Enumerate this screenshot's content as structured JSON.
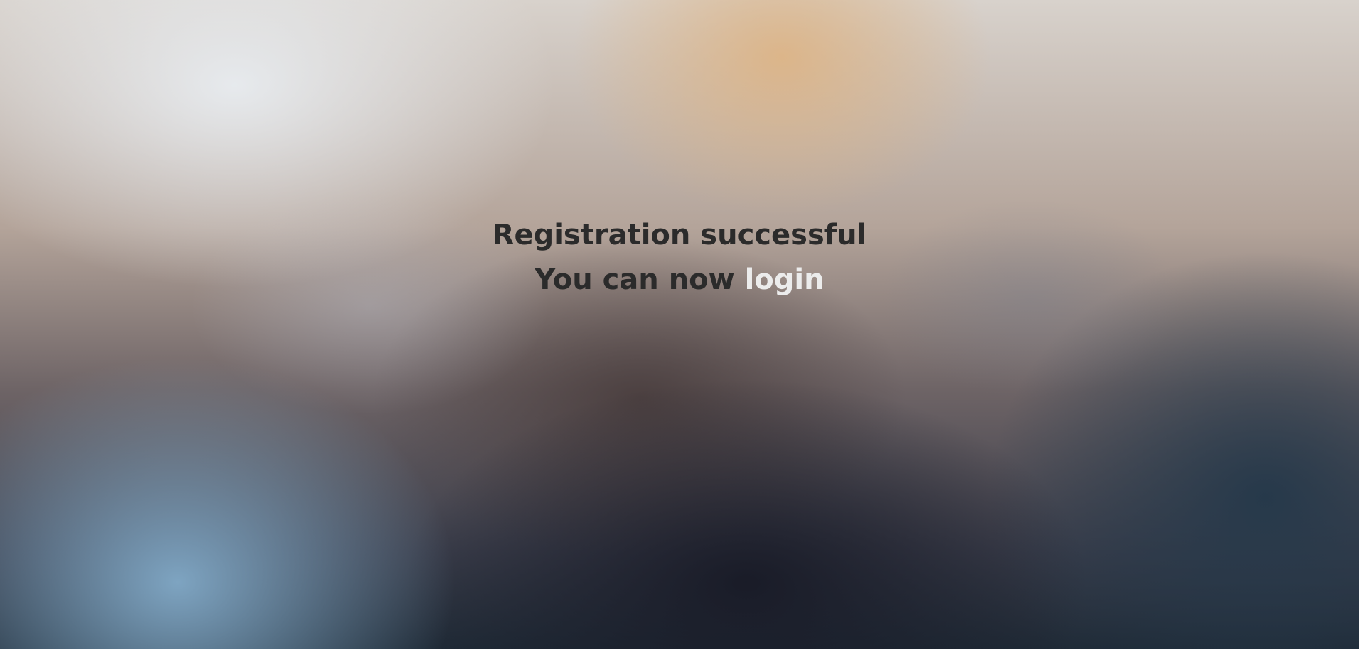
{
  "registration": {
    "title": "Registration successful",
    "subtitle_prefix": "You can now",
    "login_link": "login"
  },
  "colors": {
    "text": "#2b2b2b",
    "link": "#ececec"
  }
}
